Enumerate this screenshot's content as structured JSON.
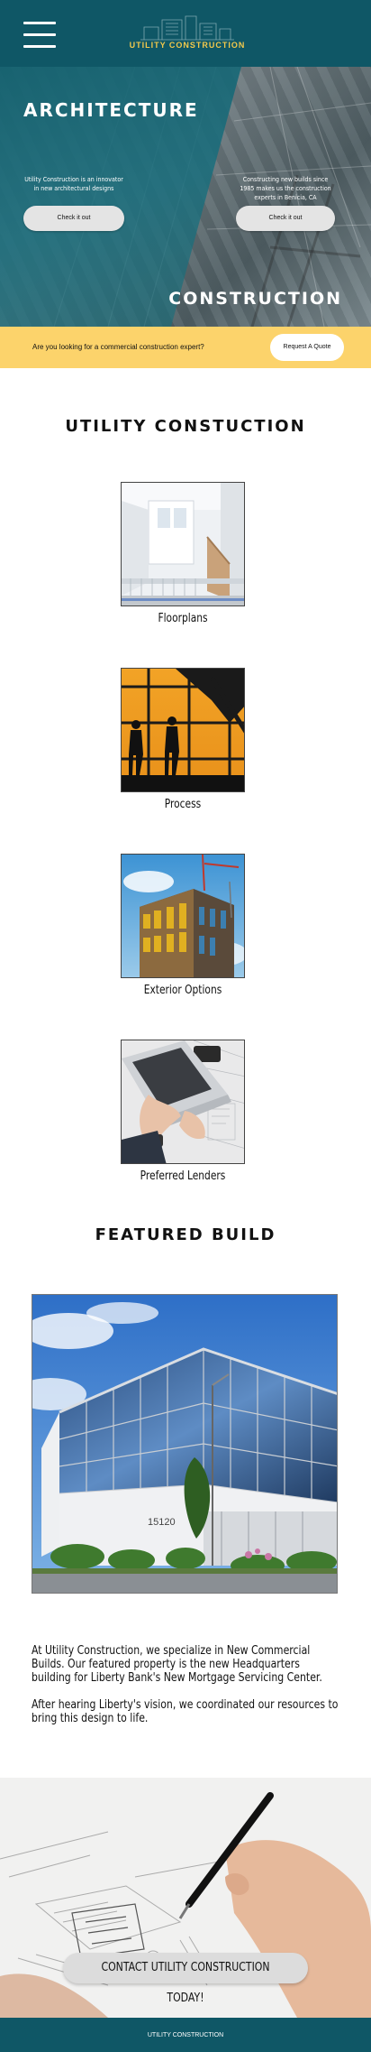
{
  "header": {
    "menu_icon": "hamburger-menu-icon",
    "logo_text": "UTILITY CONSTRUCTION",
    "background": "#0f5766",
    "logo_color": "#f2c94c"
  },
  "hero": {
    "title_left": "ARCHITECTURE",
    "title_right": "CONSTRUCTION",
    "left_text": "Utility Construction is an innovator in new architectural designs",
    "right_text": "Constructing new builds since 1985 makes us the construction experts in Benicia, CA",
    "left_button": "Check it out",
    "right_button": "Check it out"
  },
  "quote_bar": {
    "text": "Are you looking for a commercial construction expert?",
    "button": "Request A Quote",
    "background": "#fcd36b"
  },
  "services": {
    "title": "UTILITY CONSTUCTION",
    "items": [
      {
        "label": "Floorplans",
        "icon": "interior-photo"
      },
      {
        "label": "Process",
        "icon": "workers-silhouette-photo"
      },
      {
        "label": "Exterior Options",
        "icon": "building-exterior-photo"
      },
      {
        "label": "Preferred Lenders",
        "icon": "laptop-blueprint-photo"
      }
    ]
  },
  "featured": {
    "title": "FEATURED BUILD",
    "building_number": "15120",
    "paragraph1": "At Utility Construction, we specialize in New Commercial Builds. Our featured property is the new Headquarters building for Liberty Bank's New Mortgage Servicing Center.",
    "paragraph2": "After hearing Liberty's vision, we coordinated our resources to bring this design to life."
  },
  "cta": {
    "button": "CONTACT UTILITY CONSTRUCTION TODAY!"
  },
  "footer": {
    "text": "UTILITY CONSTRUCTION"
  }
}
